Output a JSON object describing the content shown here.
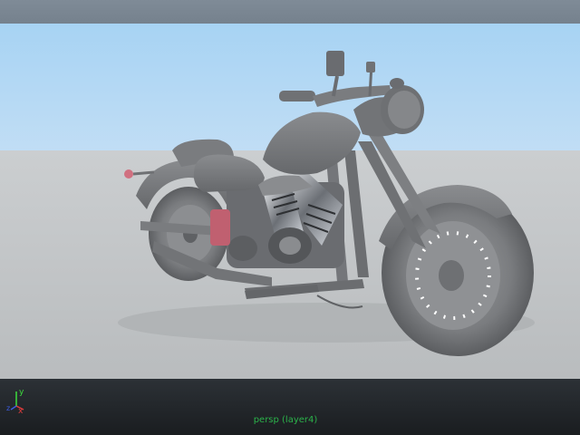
{
  "viewport": {
    "camera_label": "persp (layer4)",
    "axis": {
      "y": "y",
      "x": "x",
      "z": "z"
    }
  },
  "colors": {
    "sky_top": "#a7d3f3",
    "ground": "#c6c9cb",
    "model_body": "#7b7d80",
    "chrome_accent": "#c8ccd2",
    "red_accent": "#c06070",
    "camera_label": "#2bb24a",
    "axis_y": "#3cdc3c",
    "axis_x": "#e23c3c",
    "axis_z": "#3c5ce2"
  },
  "icons": [
    "axis-gizmo-icon"
  ]
}
